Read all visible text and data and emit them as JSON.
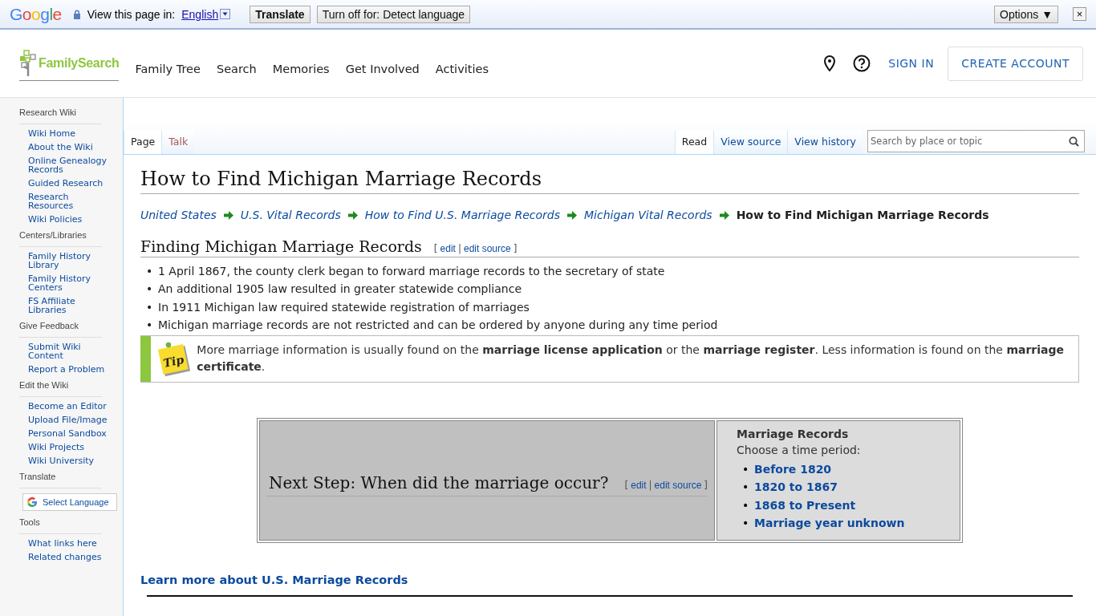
{
  "translate_bar": {
    "brand": "Google",
    "prompt": "View this page in:",
    "language": "English",
    "translate_button": "Translate",
    "turn_off_button": "Turn off for: Detect language",
    "options_button": "Options ▼",
    "close": "×"
  },
  "header": {
    "logo": "FamilySearch",
    "nav": [
      "Family Tree",
      "Search",
      "Memories",
      "Get Involved",
      "Activities"
    ],
    "sign_in": "SIGN IN",
    "create_account": "CREATE ACCOUNT"
  },
  "sidebar": [
    {
      "title": "Research Wiki",
      "kind": "links",
      "items": [
        "Wiki Home",
        "About the Wiki",
        "Online Genealogy Records",
        "Guided Research",
        "Research Resources",
        "Wiki Policies"
      ]
    },
    {
      "title": "Centers/Libraries",
      "kind": "links",
      "items": [
        "Family History Library",
        "Family History Centers",
        "FS Affiliate Libraries"
      ]
    },
    {
      "title": "Give Feedback",
      "kind": "links",
      "items": [
        "Submit Wiki Content",
        "Report a Problem"
      ]
    },
    {
      "title": "Edit the Wiki",
      "kind": "links",
      "items": [
        "Become an Editor",
        "Upload File/Image",
        "Personal Sandbox",
        "Wiki Projects",
        "Wiki University"
      ]
    },
    {
      "title": "Translate",
      "kind": "language",
      "items": [
        "Select Language"
      ]
    },
    {
      "title": "Tools",
      "kind": "links",
      "items": [
        "What links here",
        "Related changes"
      ]
    }
  ],
  "tabs_left": [
    {
      "label": "Page",
      "selected": true,
      "new": false
    },
    {
      "label": "Talk",
      "selected": false,
      "new": true
    }
  ],
  "tabs_right": [
    {
      "label": "Read",
      "selected": true,
      "new": false
    },
    {
      "label": "View source",
      "selected": false,
      "new": false
    },
    {
      "label": "View history",
      "selected": false,
      "new": false
    }
  ],
  "search": {
    "placeholder": "Search by place or topic"
  },
  "title": "How to Find Michigan Marriage Records",
  "breadcrumb": [
    {
      "label": "United States",
      "kind": "link"
    },
    {
      "label": "U.S. Vital Records",
      "kind": "link"
    },
    {
      "label": "How to Find U.S. Marriage Records",
      "kind": "link"
    },
    {
      "label": "Michigan Vital Records",
      "kind": "link"
    },
    {
      "label": "How to Find Michigan Marriage Records",
      "kind": "current"
    }
  ],
  "section": {
    "heading": "Finding Michigan Marriage Records",
    "open": "[",
    "edit": "edit",
    "sep": "|",
    "edit_source": "edit source",
    "close": "]",
    "marker": "•",
    "bullets": [
      "1 April 1867, the county clerk began to forward marriage records to the secretary of state",
      "An additional 1905 law resulted in greater statewide compliance",
      "In 1911 Michigan law required statewide registration of marriages",
      "Michigan marriage records are not restricted and can be ordered by anyone during any time period"
    ],
    "tip": {
      "icon_label": "Tip",
      "text": "More marriage information is usually found on the **marriage license application** or the **marriage register**. Less information is found on the **marriage certificate**."
    }
  },
  "next_step": {
    "heading": "Next Step: When did the marriage occur?",
    "open": "[",
    "edit": "edit",
    "sep": "|",
    "edit_source": "edit source",
    "close": "]",
    "marker": "•",
    "box_title": "Marriage Records",
    "box_prompt": "Choose a time period:",
    "options": [
      "Before 1820",
      "1820 to 1867",
      "1868 to Present",
      "Marriage year unknown"
    ]
  },
  "learn_more": "Learn more about U.S. Marriage Records"
}
